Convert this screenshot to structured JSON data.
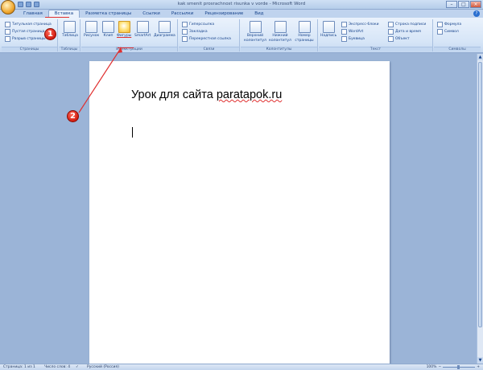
{
  "window": {
    "title": "kak smenit prosrachnost risunka v vorde - Microsoft Word",
    "minimize": "–",
    "maximize": "□",
    "close": "×"
  },
  "tabs": [
    "Главная",
    "Вставка",
    "Разметка страницы",
    "Ссылки",
    "Рассылки",
    "Рецензирование",
    "Вид"
  ],
  "active_tab": "Вставка",
  "ribbon": {
    "pages": {
      "items": [
        "Титульная страница",
        "Пустая страница",
        "Разрыв страницы"
      ],
      "label": "Страницы"
    },
    "tables": {
      "button": "Таблица",
      "label": "Таблицы"
    },
    "illustrations": {
      "buttons": [
        "Рисунок",
        "Клип",
        "Фигуры",
        "SmartArt",
        "Диаграмма"
      ],
      "label": "Иллюстрации"
    },
    "links": {
      "items": [
        "Гиперссылка",
        "Закладка",
        "Перекрестная ссылка"
      ],
      "label": "Связи"
    },
    "header_footer": {
      "buttons": [
        "Верхний колонтитул",
        "Нижний колонтитул",
        "Номер страницы"
      ],
      "label": "Колонтитулы"
    },
    "text": {
      "big": "Надпись",
      "items": [
        "Экспресс-блоки",
        "WordArt",
        "Буквица"
      ],
      "items2": [
        "Строка подписи",
        "Дата и время",
        "Объект"
      ],
      "label": "Текст"
    },
    "symbols": {
      "items": [
        "Формула",
        "Символ"
      ],
      "label": "Символы"
    }
  },
  "annotations": {
    "marker1": "1",
    "marker2": "2"
  },
  "document": {
    "heading_prefix": "Урок для сайта ",
    "heading_link": "paratapok.ru"
  },
  "status": {
    "page": "Страница: 1 из 1",
    "words": "Число слов: 4",
    "language": "Русский (Россия)",
    "zoom": "100%"
  },
  "colors": {
    "ribbon": "#d6e5f7",
    "workspace": "#9bb4d7",
    "annotation": "#e03030"
  }
}
